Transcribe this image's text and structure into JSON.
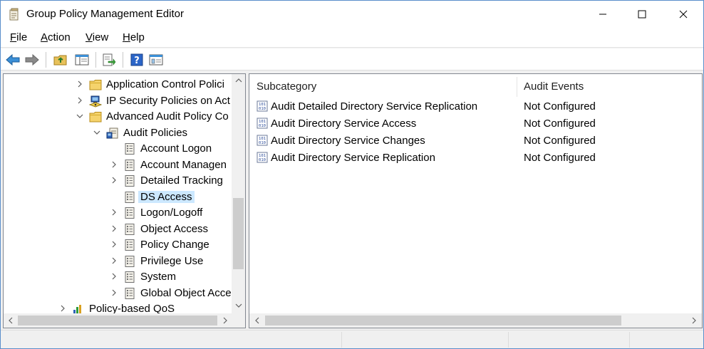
{
  "window": {
    "title": "Group Policy Management Editor"
  },
  "menu": [
    {
      "label": "File",
      "key": "F",
      "rest": "ile"
    },
    {
      "label": "Action",
      "key": "A",
      "rest": "ction"
    },
    {
      "label": "View",
      "key": "V",
      "rest": "iew"
    },
    {
      "label": "Help",
      "key": "H",
      "rest": "elp"
    }
  ],
  "toolbar": {
    "back_icon": "back-arrow-icon",
    "forward_icon": "forward-arrow-icon",
    "up_icon": "folder-up-icon",
    "console_tree_icon": "show-hide-tree-icon",
    "export_icon": "export-list-icon",
    "help_icon": "help-icon",
    "properties_icon": "properties-icon"
  },
  "tree": [
    {
      "label": "Application Control Polici",
      "expander": "collapsed",
      "icon": "folder-icon",
      "indent": 0
    },
    {
      "label": "IP Security Policies on Act",
      "expander": "collapsed",
      "icon": "ip-security-icon",
      "indent": 0
    },
    {
      "label": "Advanced Audit Policy Co",
      "expander": "expanded",
      "icon": "folder-icon",
      "indent": 0
    },
    {
      "label": "Audit Policies",
      "expander": "expanded",
      "icon": "audit-policies-icon",
      "indent": 1
    },
    {
      "label": "Account Logon",
      "expander": "none",
      "icon": "policy-icon",
      "indent": 2
    },
    {
      "label": "Account Managen",
      "expander": "collapsed",
      "icon": "policy-icon",
      "indent": 2
    },
    {
      "label": "Detailed Tracking",
      "expander": "collapsed",
      "icon": "policy-icon",
      "indent": 2
    },
    {
      "label": "DS Access",
      "expander": "none",
      "icon": "policy-icon",
      "indent": 2,
      "selected": true
    },
    {
      "label": "Logon/Logoff",
      "expander": "collapsed",
      "icon": "policy-icon",
      "indent": 2
    },
    {
      "label": "Object Access",
      "expander": "collapsed",
      "icon": "policy-icon",
      "indent": 2
    },
    {
      "label": "Policy Change",
      "expander": "collapsed",
      "icon": "policy-icon",
      "indent": 2
    },
    {
      "label": "Privilege Use",
      "expander": "collapsed",
      "icon": "policy-icon",
      "indent": 2
    },
    {
      "label": "System",
      "expander": "collapsed",
      "icon": "policy-icon",
      "indent": 2
    },
    {
      "label": "Global Object Acce",
      "expander": "collapsed",
      "icon": "policy-icon",
      "indent": 2
    },
    {
      "label": "Policy-based QoS",
      "expander": "collapsed",
      "icon": "qos-icon",
      "indent": -1
    }
  ],
  "list": {
    "columns": [
      "Subcategory",
      "Audit Events"
    ],
    "rows": [
      {
        "subcategory": "Audit Detailed Directory Service Replication",
        "events": "Not Configured"
      },
      {
        "subcategory": "Audit Directory Service Access",
        "events": "Not Configured"
      },
      {
        "subcategory": "Audit Directory Service Changes",
        "events": "Not Configured"
      },
      {
        "subcategory": "Audit Directory Service Replication",
        "events": "Not Configured"
      }
    ]
  },
  "colors": {
    "selection": "#cce8ff",
    "accent": "#0078d7",
    "border": "#828790"
  }
}
